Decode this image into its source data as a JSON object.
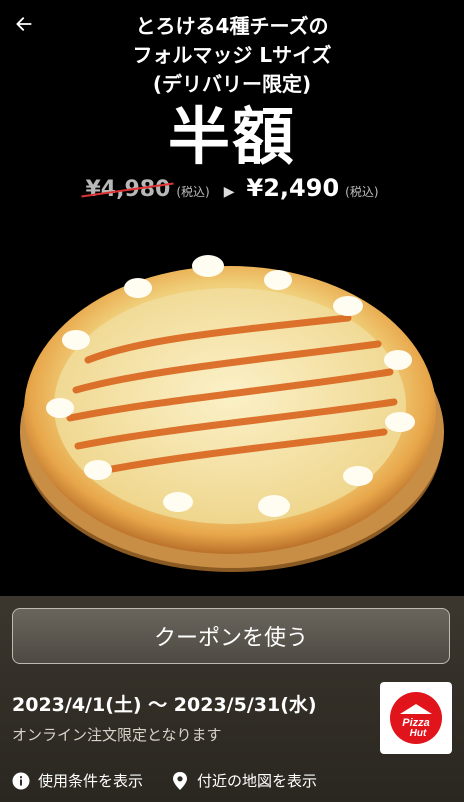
{
  "header": {
    "back_icon": "arrow-left-icon",
    "title_lines": [
      "とろける4種チーズの",
      "フォルマッジ Lサイズ",
      "(デリバリー限定)"
    ]
  },
  "headline": "半額",
  "price": {
    "old": "¥4,980",
    "old_tax": "(税込)",
    "arrow": "▶",
    "new": "¥2,490",
    "new_tax": "(税込)"
  },
  "product_image": "pizza-formaggio-image",
  "coupon": {
    "button_label": "クーポンを使う",
    "period": "2023/4/1(土) 〜 2023/5/31(水)",
    "note": "オンライン注文限定となります",
    "logo_text": "Pizza Hut"
  },
  "links": [
    {
      "icon": "info-icon",
      "label": "使用条件を表示"
    },
    {
      "icon": "map-pin-icon",
      "label": "付近の地図を表示"
    }
  ],
  "colors": {
    "background": "#000000",
    "bottom_panel": "#3b362e",
    "strike": "#dd3333",
    "brand_red": "#e1141c"
  }
}
